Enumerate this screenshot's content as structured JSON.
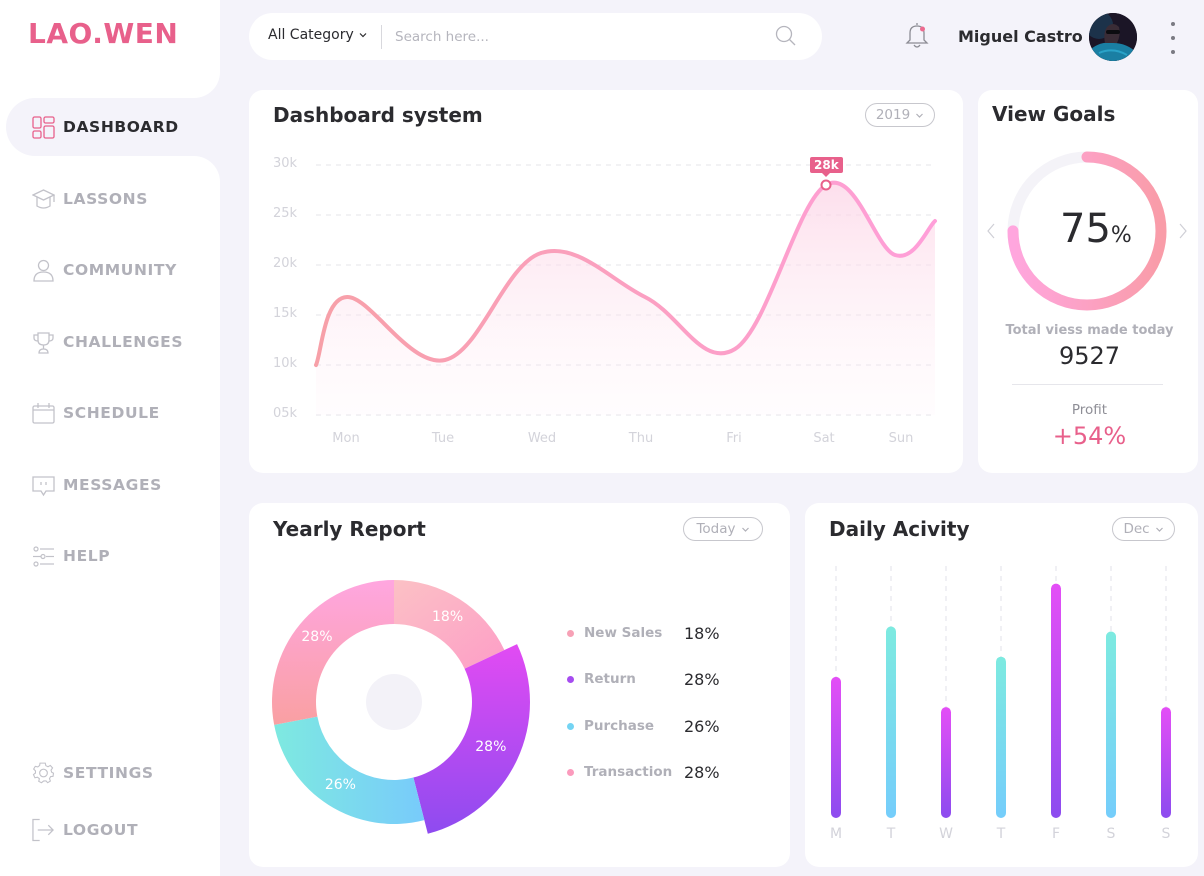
{
  "app": {
    "logo": "LAO.WEN"
  },
  "sidebar": {
    "items": [
      {
        "id": "dashboard",
        "label": "DASHBOARD",
        "icon": "dashboard-grid-icon",
        "active": true
      },
      {
        "id": "lassons",
        "label": "LASSONS",
        "icon": "graduation-cap-icon",
        "active": false
      },
      {
        "id": "community",
        "label": "COMMUNITY",
        "icon": "user-icon",
        "active": false
      },
      {
        "id": "challenges",
        "label": "CHALLENGES",
        "icon": "trophy-icon",
        "active": false
      },
      {
        "id": "schedule",
        "label": "SCHEDULE",
        "icon": "calendar-icon",
        "active": false
      },
      {
        "id": "messages",
        "label": "MESSAGES",
        "icon": "message-icon",
        "active": false
      },
      {
        "id": "help",
        "label": "HELP",
        "icon": "sliders-icon",
        "active": false
      }
    ],
    "bottom": [
      {
        "id": "settings",
        "label": "SETTINGS",
        "icon": "gear-icon"
      },
      {
        "id": "logout",
        "label": "LOGOUT",
        "icon": "logout-icon"
      }
    ]
  },
  "topbar": {
    "category": "All Category",
    "search_placeholder": "Search here...",
    "search_value": "",
    "username": "Miguel Castro",
    "notification_dot": true
  },
  "colors": {
    "accent": "#e8608b",
    "line_start": "#f8a0a8",
    "line_end": "#ff9fd8",
    "purple": "#a34cf0",
    "magenta": "#e14ef5",
    "cyan": "#7ce8e0",
    "sky": "#77cffb"
  },
  "dashboard": {
    "title": "Dashboard system",
    "year_filter": "2019",
    "tooltip": "28k"
  },
  "goals": {
    "title": "View Goals",
    "percent_value": "75",
    "percent_sign": "%",
    "progress": 0.75,
    "views_label": "Total viess made today",
    "views_value": "9527",
    "profit_label": "Profit",
    "profit_value": "+54%"
  },
  "yearly": {
    "title": "Yearly Report",
    "filter": "Today"
  },
  "daily": {
    "title": "Daily Acivity",
    "filter": "Dec"
  },
  "chart_data": [
    {
      "type": "line",
      "title": "Dashboard system",
      "x": [
        "Mon",
        "Tue",
        "Wed",
        "Thu",
        "Fri",
        "Sat",
        "Sun"
      ],
      "yticks": [
        "30k",
        "25k",
        "20k",
        "15k",
        "10k",
        "05k"
      ],
      "ylim": [
        5,
        30
      ],
      "unit": "k",
      "points": [
        {
          "x": "start",
          "y": 10
        },
        {
          "x": "Mon",
          "y": 16.8
        },
        {
          "x": "Tue",
          "y": 10.5
        },
        {
          "x": "Wed",
          "y": 21.2
        },
        {
          "x": "Thu",
          "y": 16.8
        },
        {
          "x": "Fri",
          "y": 11.6
        },
        {
          "x": "Sat",
          "y": 28
        },
        {
          "x": "Sun",
          "y": 21
        },
        {
          "x": "end",
          "y": 24.4
        }
      ],
      "highlight": {
        "x": "Sat",
        "y": 28,
        "label": "28k"
      },
      "grid": true
    },
    {
      "type": "pie",
      "title": "Yearly Report",
      "donut": true,
      "slices": [
        {
          "name": "New Sales",
          "value": 18,
          "label": "18%",
          "color": "#ffb3c6"
        },
        {
          "name": "Return",
          "value": 28,
          "label": "28%",
          "color": "#b848f2",
          "exploded": true
        },
        {
          "name": "Purchase",
          "value": 26,
          "label": "26%",
          "color": "#7ad9f0"
        },
        {
          "name": "Transaction",
          "value": 28,
          "label": "28%",
          "color": "#fd9fc4"
        }
      ],
      "legend": [
        {
          "name": "New Sales",
          "value": "18%",
          "color": "#f7a1b6"
        },
        {
          "name": "Return",
          "value": "28%",
          "color": "#a64cf0"
        },
        {
          "name": "Purchase",
          "value": "26%",
          "color": "#74d4f3"
        },
        {
          "name": "Transaction",
          "value": "28%",
          "color": "#fb9bbd"
        }
      ],
      "legend_position": "right"
    },
    {
      "type": "bar",
      "title": "Daily Acivity",
      "categories": [
        "M",
        "T",
        "W",
        "T",
        "F",
        "S",
        "S"
      ],
      "values": [
        56,
        76,
        44,
        64,
        93,
        74,
        44
      ],
      "styles": [
        "purple",
        "cyan",
        "purple",
        "cyan",
        "purple",
        "cyan",
        "purple"
      ],
      "ylim": [
        0,
        100
      ]
    }
  ]
}
